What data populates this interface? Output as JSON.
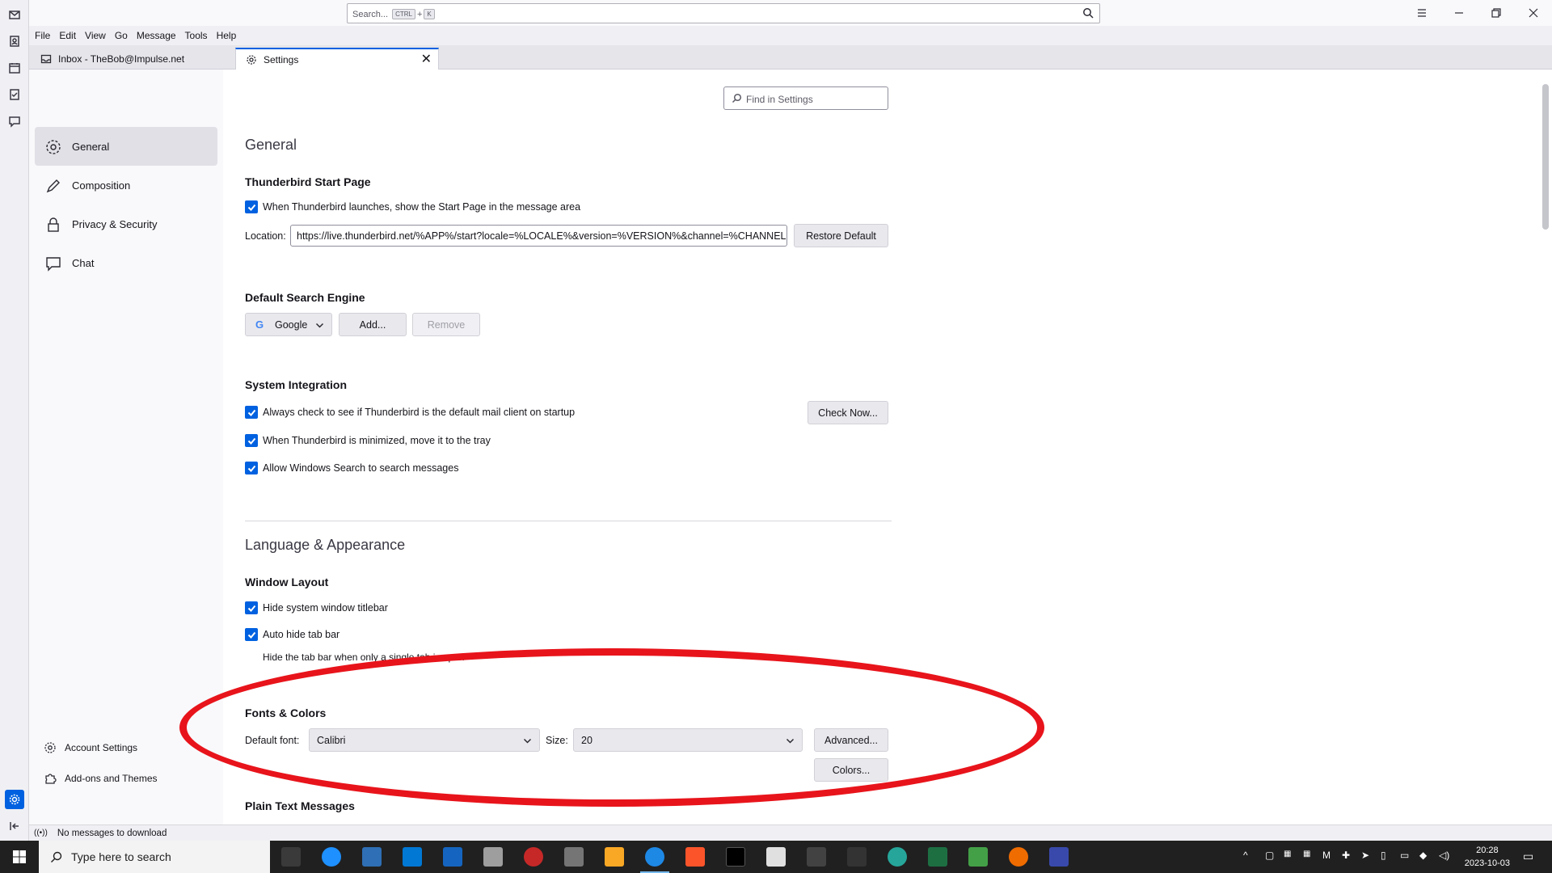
{
  "spaces": {
    "items": [
      "mail-icon",
      "address-book-icon",
      "calendar-icon",
      "tasks-icon",
      "chat-icon"
    ],
    "bottom": [
      "settings-icon",
      "collapse-icon"
    ]
  },
  "titlebar": {
    "search_placeholder": "Search...",
    "shortcut_mod": "CTRL",
    "shortcut_plus": "+",
    "shortcut_key": "K"
  },
  "menubar": {
    "items": [
      "File",
      "Edit",
      "View",
      "Go",
      "Message",
      "Tools",
      "Help"
    ]
  },
  "tabs": {
    "inbox": "Inbox - TheBob@Impulse.net",
    "settings": "Settings"
  },
  "sidebar": {
    "categories": [
      "General",
      "Composition",
      "Privacy & Security",
      "Chat"
    ],
    "selected": "General",
    "bottom": [
      "Account Settings",
      "Add-ons and Themes"
    ]
  },
  "settings": {
    "find_placeholder": "Find in Settings",
    "general_heading": "General",
    "start_page": {
      "title": "Thunderbird Start Page",
      "checkbox": "When Thunderbird launches, show the Start Page in the message area",
      "location_label": "Location:",
      "location_value": "https://live.thunderbird.net/%APP%/start?locale=%LOCALE%&version=%VERSION%&channel=%CHANNEL%",
      "restore_button": "Restore Default"
    },
    "search_engine": {
      "title": "Default Search Engine",
      "engine": "Google",
      "add_button": "Add...",
      "remove_button": "Remove"
    },
    "system_integration": {
      "title": "System Integration",
      "always_check": "Always check to see if Thunderbird is the default mail client on startup",
      "check_now_button": "Check Now...",
      "minimize_tray": "When Thunderbird is minimized, move it to the tray",
      "windows_search": "Allow Windows Search to search messages"
    },
    "language_heading": "Language & Appearance",
    "window_layout": {
      "title": "Window Layout",
      "hide_titlebar": "Hide system window titlebar",
      "auto_hide_tabbar": "Auto hide tab bar",
      "auto_hide_hint": "Hide the tab bar when only a single tab is open"
    },
    "fonts": {
      "title": "Fonts & Colors",
      "default_font_label": "Default font:",
      "default_font_value": "Calibri",
      "size_label": "Size:",
      "size_value": "20",
      "advanced_button": "Advanced...",
      "colors_button": "Colors..."
    },
    "plain_text_title": "Plain Text Messages"
  },
  "statusbar": {
    "text": "No messages to download"
  },
  "taskbar": {
    "search_placeholder": "Type here to search",
    "time": "20:28",
    "date": "2023-10-03"
  },
  "annotation": {
    "color": "#e8141b"
  }
}
